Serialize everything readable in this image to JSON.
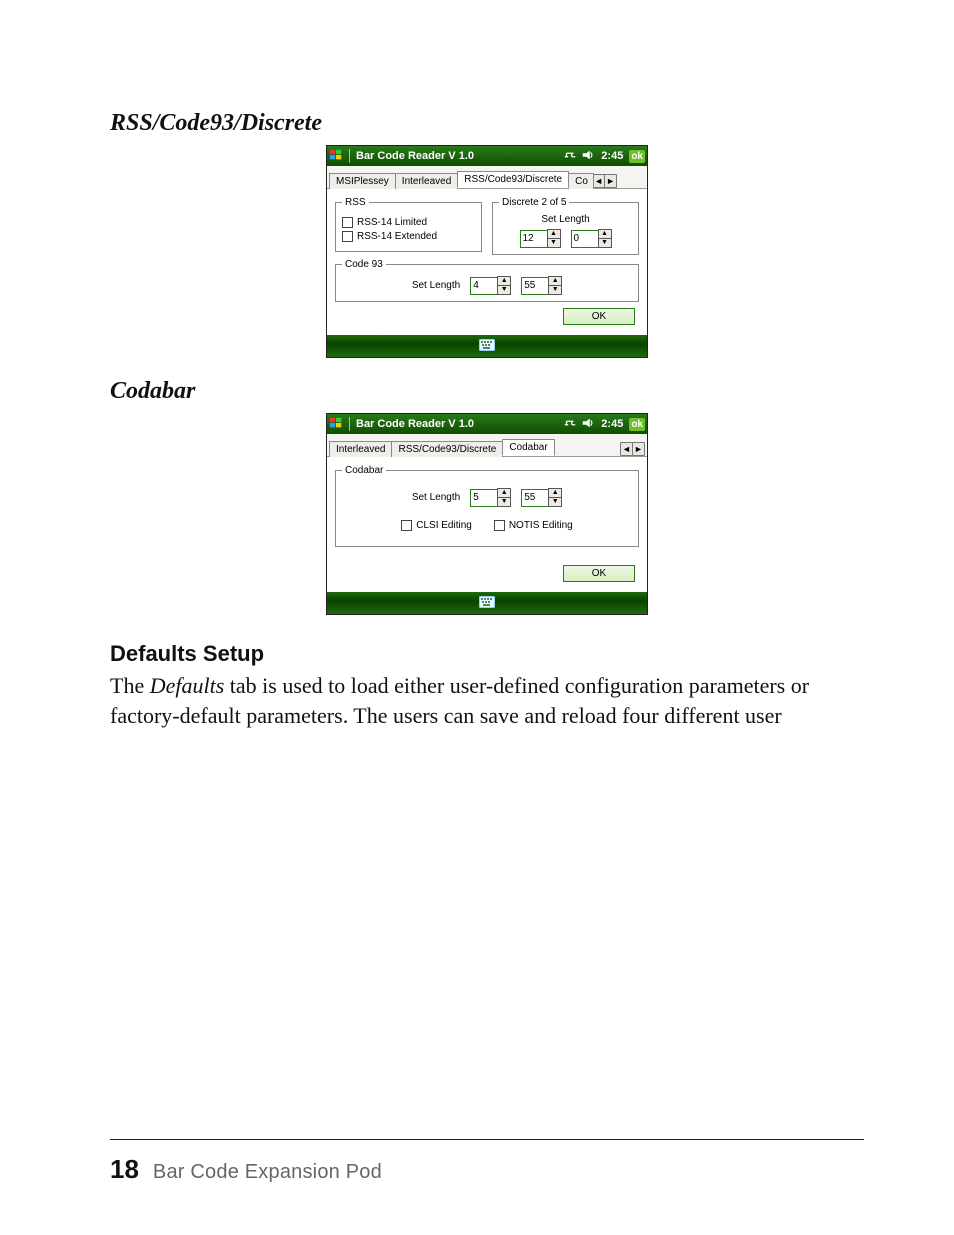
{
  "doc": {
    "heading_rss": "RSS/Code93/Discrete",
    "heading_codabar": "Codabar",
    "heading_defaults": "Defaults Setup",
    "para_defaults_pre": "The ",
    "para_defaults_em": "Defaults",
    "para_defaults_post": " tab is used to load either user-defined configuration parameters or factory-default parameters. The users can save and reload four different user",
    "page_number": "18",
    "footer_title": "Bar Code Expansion Pod"
  },
  "shot1": {
    "title": "Bar Code Reader V 1.0",
    "clock": "2:45",
    "ok_pill": "ok",
    "tabs": {
      "t1": "MSIPlessey",
      "t2": "Interleaved",
      "t3": "RSS/Code93/Discrete",
      "t4": "Co"
    },
    "rss": {
      "legend": "RSS",
      "chk1": "RSS-14 Limited",
      "chk2": "RSS-14 Extended"
    },
    "d25": {
      "legend": "Discrete 2 of 5",
      "set_length": "Set Length",
      "min": "12",
      "max": "0"
    },
    "code93": {
      "legend": "Code 93",
      "set_length": "Set Length",
      "min": "4",
      "max": "55"
    },
    "ok_btn": "OK"
  },
  "shot2": {
    "title": "Bar Code Reader V 1.0",
    "clock": "2:45",
    "ok_pill": "ok",
    "tabs": {
      "t1": "Interleaved",
      "t2": "RSS/Code93/Discrete",
      "t3": "Codabar"
    },
    "codabar": {
      "legend": "Codabar",
      "set_length": "Set Length",
      "min": "5",
      "max": "55",
      "chk1": "CLSI Editing",
      "chk2": "NOTIS Editing"
    },
    "ok_btn": "OK"
  }
}
